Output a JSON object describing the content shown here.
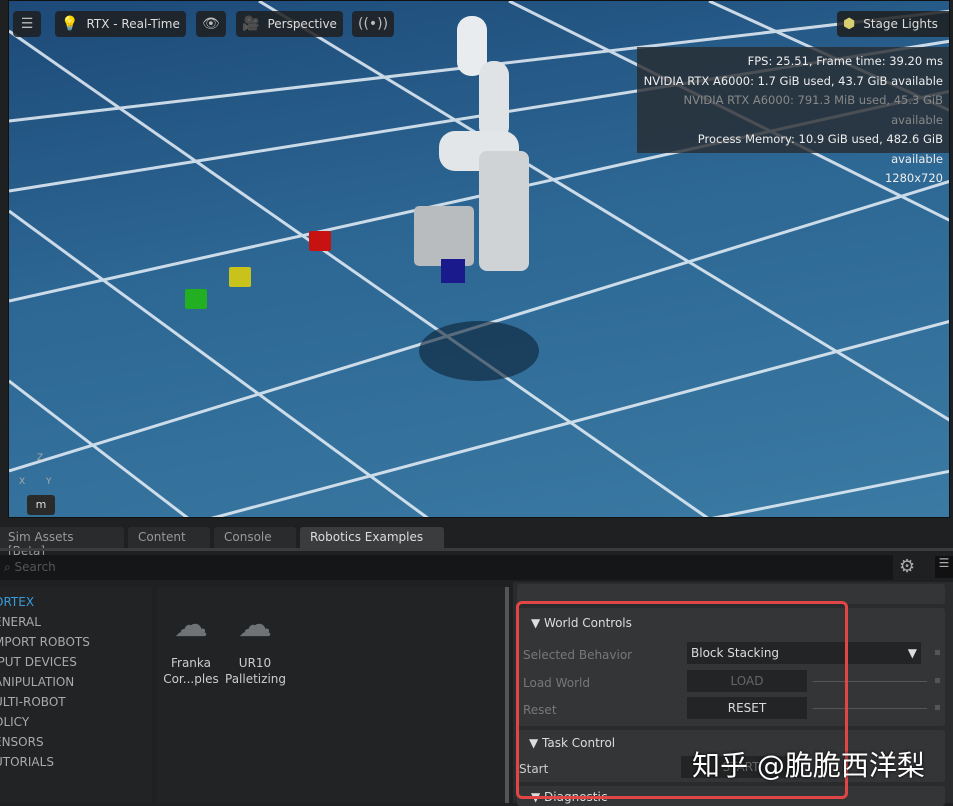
{
  "toolbar": {
    "render_mode": "RTX - Real-Time",
    "camera": "Perspective",
    "lights": "Stage Lights"
  },
  "stats": {
    "fps": "FPS: 25.51, Frame time: 39.20 ms",
    "gpu1": "NVIDIA RTX A6000: 1.7 GiB used, 43.7 GiB available",
    "gpu2": "NVIDIA RTX A6000: 791.3 MiB used, 45.3 GiB available",
    "process": "Process Memory: 10.9 GiB used, 482.6 GiB available",
    "resolution": "1280x720"
  },
  "axis": {
    "z": "Z",
    "x": "X",
    "y": "Y"
  },
  "viewport_unit": "m",
  "tabs": [
    "Sim Assets [Beta]",
    "Content",
    "Console",
    "Robotics Examples"
  ],
  "search": {
    "placeholder": "Search"
  },
  "categories": [
    "ORTEX",
    "ENERAL",
    "MPORT ROBOTS",
    "IPUT DEVICES",
    "ANIPULATION",
    "ULTI-ROBOT",
    "OLICY",
    "ENSORS",
    "UTORIALS"
  ],
  "examples": [
    {
      "line1": "Franka",
      "line2": "Cor...ples"
    },
    {
      "line1": "UR10",
      "line2": "Palletizing"
    }
  ],
  "world_controls": {
    "title": "World Controls",
    "selected_behavior_label": "Selected Behavior",
    "selected_behavior": "Block Stacking",
    "load_world_label": "Load World",
    "load_button": "LOAD",
    "reset_label": "Reset",
    "reset_button": "RESET"
  },
  "task_control": {
    "title": "Task Control",
    "start_label": "Start",
    "start_button": "START"
  },
  "diagnostic": {
    "title": "Diagnostic"
  },
  "watermark": "知乎 @脆脆西洋梨"
}
